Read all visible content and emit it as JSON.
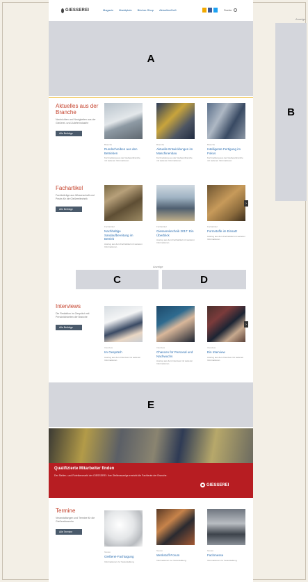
{
  "header": {
    "logo_text": "GIESSEREI",
    "nav": [
      "Magazin",
      "Marktplatz",
      "Bücher-Shop",
      "Aktuelles/Heft"
    ],
    "tools_label": "Suche"
  },
  "ads": {
    "anzeige_label": "Anzeige",
    "a": "A",
    "b": "B",
    "c": "C",
    "d": "D",
    "e": "E"
  },
  "sections": {
    "branche": {
      "title": "Aktuelles aus der Branche",
      "desc": "Nachrichten und Neuigkeiten aus der Gießerei- und Zulieferindustrie",
      "button": "Alle Beiträge",
      "cards": [
        {
          "cat": "Branche",
          "title": "Rundschreiben aus den Betrieben",
          "text": "Kurzmeldung aus der Gießereibranche mit weiteren Informationen."
        },
        {
          "cat": "Branche",
          "title": "Aktuelle Entwicklungen im Maschinenbau",
          "text": "Kurzmeldung aus der Gießereibranche mit weiteren Informationen."
        },
        {
          "cat": "Branche",
          "title": "Intelligente Fertigung im Fokus",
          "text": "Kurzmeldung aus der Gießereibranche mit weiteren Informationen."
        }
      ]
    },
    "fachartikel": {
      "title": "Fachartikel",
      "desc": "Fachbeiträge aus Wissenschaft und Praxis für die Gießereitechnik",
      "button": "Alle Beiträge",
      "cards": [
        {
          "cat": "Fachartikel",
          "title": "Nachhaltige Sandaufbereitung im Betrieb",
          "text": "Auszug aus dem Fachartikel mit weiteren Informationen."
        },
        {
          "cat": "Fachartikel",
          "title": "Giessereitechnik 2017: Ein Überblick",
          "text": "Auszug aus dem Fachartikel mit weiteren Informationen."
        },
        {
          "cat": "Fachartikel",
          "title": "Formstoffe im Einsatz",
          "text": "Auszug aus dem Fachartikel mit weiteren Informationen."
        }
      ]
    },
    "interviews": {
      "title": "Interviews",
      "desc": "Die Redaktion im Gespräch mit Persönlichkeiten der Branche",
      "button": "Alle Beiträge",
      "cards": [
        {
          "cat": "Interview",
          "title": "Im Gespräch",
          "text": "Auszug aus dem Interview mit weiteren Informationen."
        },
        {
          "cat": "Interview",
          "title": "Chancen für Personal und Nachwuchs",
          "text": "Auszug aus dem Interview mit weiteren Informationen."
        },
        {
          "cat": "Interview",
          "title": "Ein Interview",
          "text": "Auszug aus dem Interview mit weiteren Informationen."
        }
      ]
    },
    "termine": {
      "title": "Termine",
      "desc": "Veranstaltungen und Termine für die Gießereibranche",
      "button": "Alle Termine",
      "cards": [
        {
          "cat": "Termin",
          "title": "Gießerei-Fachtagung",
          "text": "Informationen zur Veranstaltung."
        },
        {
          "cat": "Termin",
          "title": "Werkstoff-Forum",
          "text": "Informationen zur Veranstaltung."
        },
        {
          "cat": "Termin",
          "title": "Fachmesse",
          "text": "Informationen zur Veranstaltung."
        }
      ]
    }
  },
  "banner": {
    "title": "Qualifizierte Mitarbeiter finden",
    "text": "Der Stellen- und Rubrikenmarkt der GIESSEREI: Ihre Stellenanzeige erreicht die Fachleute der Branche.",
    "logo": "GIESSEREI"
  },
  "colors": {
    "accent_red": "#c4402a",
    "link_blue": "#2a6db0",
    "banner_red": "#b71d22",
    "ad_gray": "#d4d6dc"
  }
}
